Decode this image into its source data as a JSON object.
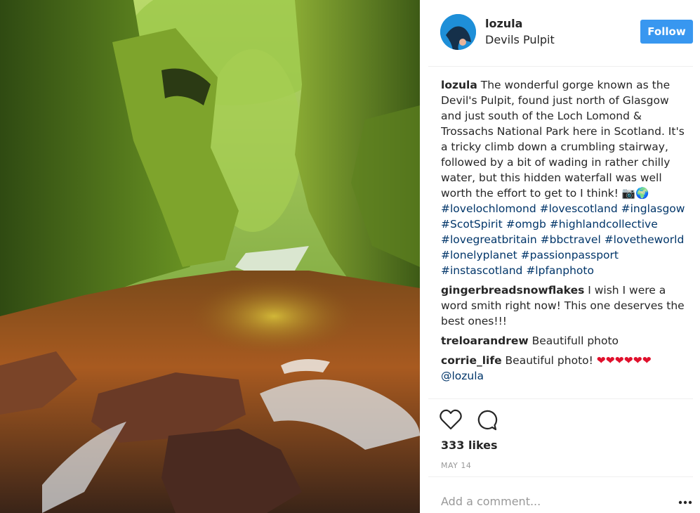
{
  "post": {
    "username": "lozula",
    "location": "Devils Pulpit",
    "follow_label": "Follow"
  },
  "caption": {
    "username": "lozula",
    "text": "The wonderful gorge known as the Devil's Pulpit, found just north of Glasgow and just south of the Loch Lomond & Trossachs National Park here in Scotland. It's a tricky climb down a crumbling stairway, followed by a bit of wading in rather chilly water, but this hidden waterfall was well worth the effort to get to I think!",
    "emoji": "📷🌍",
    "hashtags": "#lovelochlomond #lovescotland #inglasgow #ScotSpirit #omgb #highlandcollective #lovegreatbritain #bbctravel #lovetheworld #lonelyplanet #passionpassport #instascotland #lpfanphoto"
  },
  "comments": [
    {
      "username": "gingerbreadsnowflakes",
      "text": "I wish I were a word smith right now! This one deserves the best ones!!!"
    },
    {
      "username": "treloarandrew",
      "text": "Beautifull photo"
    },
    {
      "username": "corrie_life",
      "text": "Beautiful photo!",
      "hearts": "❤❤❤❤❤❤",
      "mention": "@lozula"
    }
  ],
  "actions": {
    "like_icon": "heart-outline-icon",
    "comment_icon": "speech-bubble-icon",
    "likes": "333 likes",
    "date": "MAY 14"
  },
  "add_comment": {
    "placeholder": "Add a comment...",
    "more_icon": "ellipsis-icon"
  },
  "colors": {
    "follow_button": "#3897f0",
    "hashtag": "#003569",
    "heart": "#e0102c",
    "muted": "#999999"
  }
}
